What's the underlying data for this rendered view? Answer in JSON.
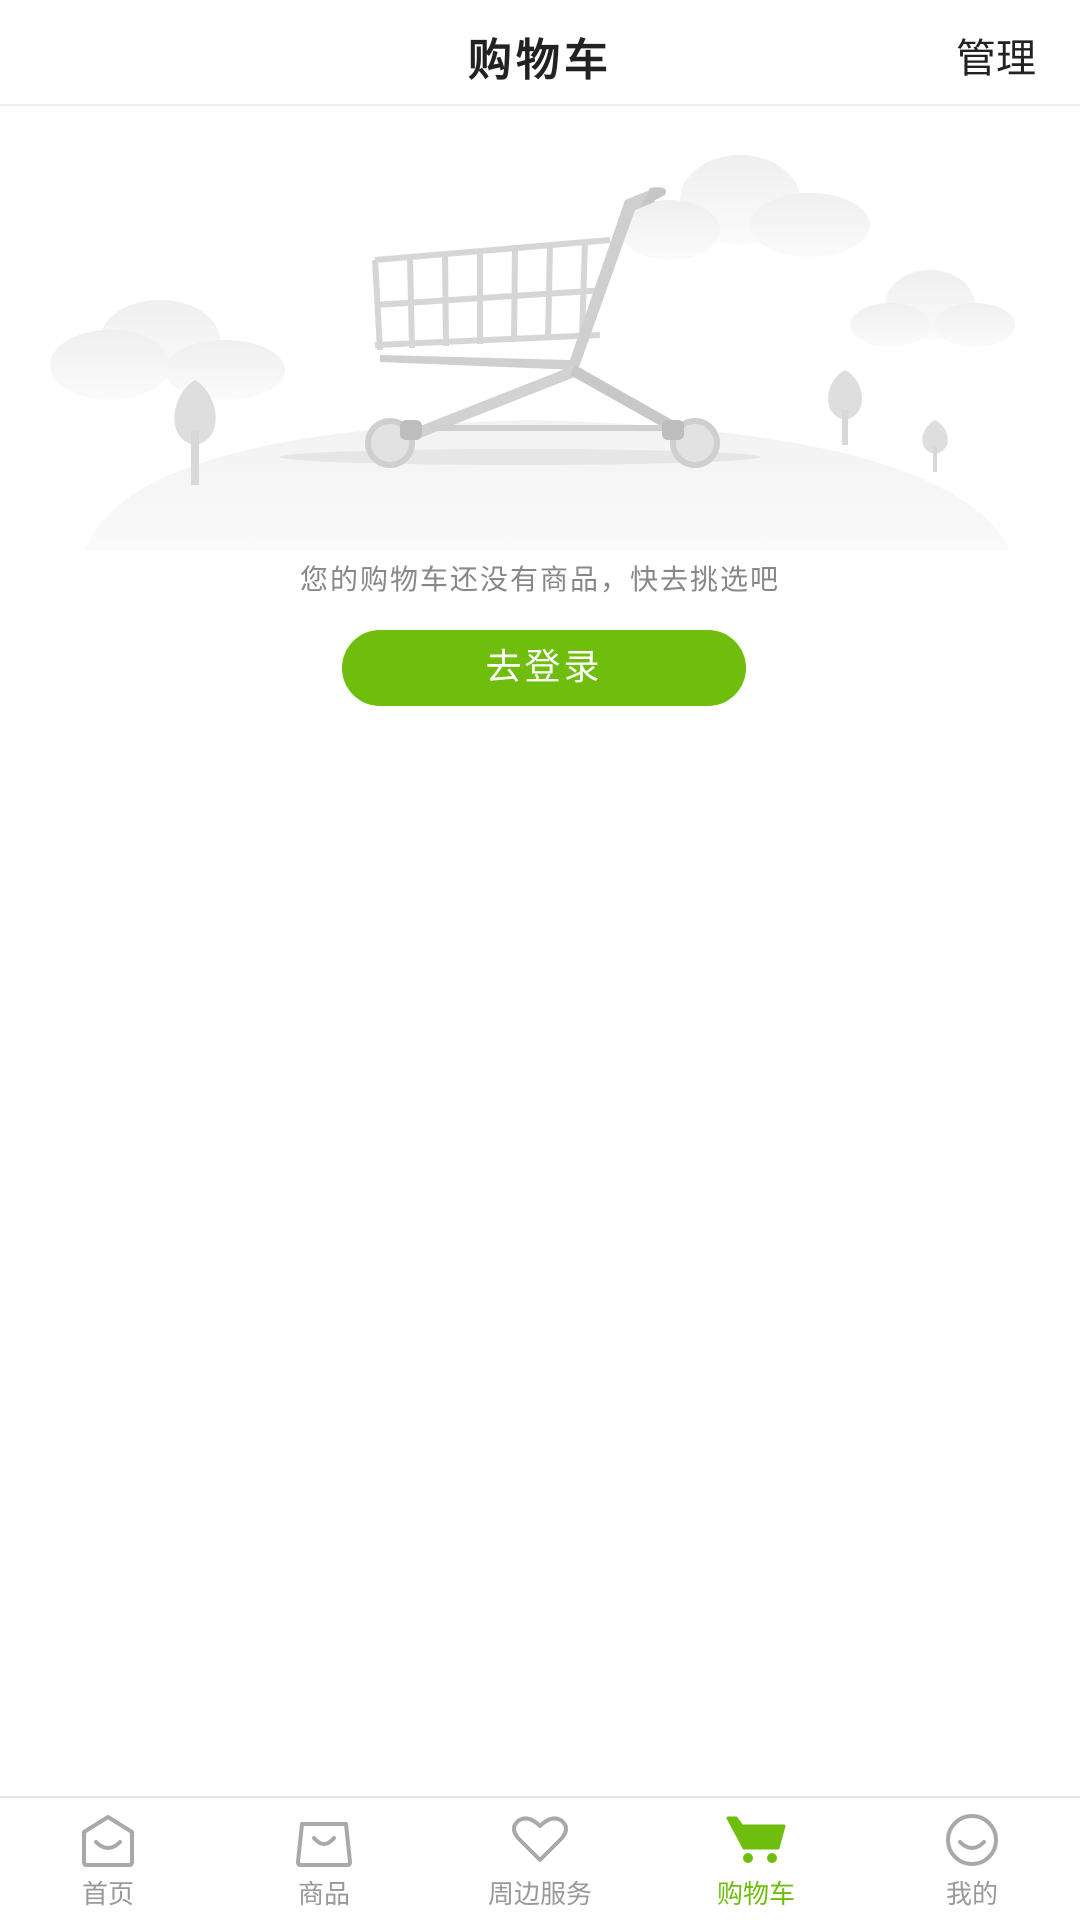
{
  "header": {
    "title": "购物车",
    "manage_label": "管理"
  },
  "empty_state": {
    "message": "您的购物车还没有商品，快去挑选吧",
    "button_label": "去登录",
    "illustration_icon": "shopping-cart-illustration"
  },
  "tabbar": {
    "active_color": "#6fbe0e",
    "inactive_color": "#999999",
    "items": [
      {
        "label": "首页",
        "icon": "home-bag-icon",
        "active": false
      },
      {
        "label": "商品",
        "icon": "shopping-bag-icon",
        "active": false
      },
      {
        "label": "周边服务",
        "icon": "heart-icon",
        "active": false
      },
      {
        "label": "购物车",
        "icon": "cart-icon",
        "active": true
      },
      {
        "label": "我的",
        "icon": "smile-face-icon",
        "active": false
      }
    ]
  },
  "colors": {
    "accent": "#6fbe0e",
    "text_muted": "#888888"
  }
}
